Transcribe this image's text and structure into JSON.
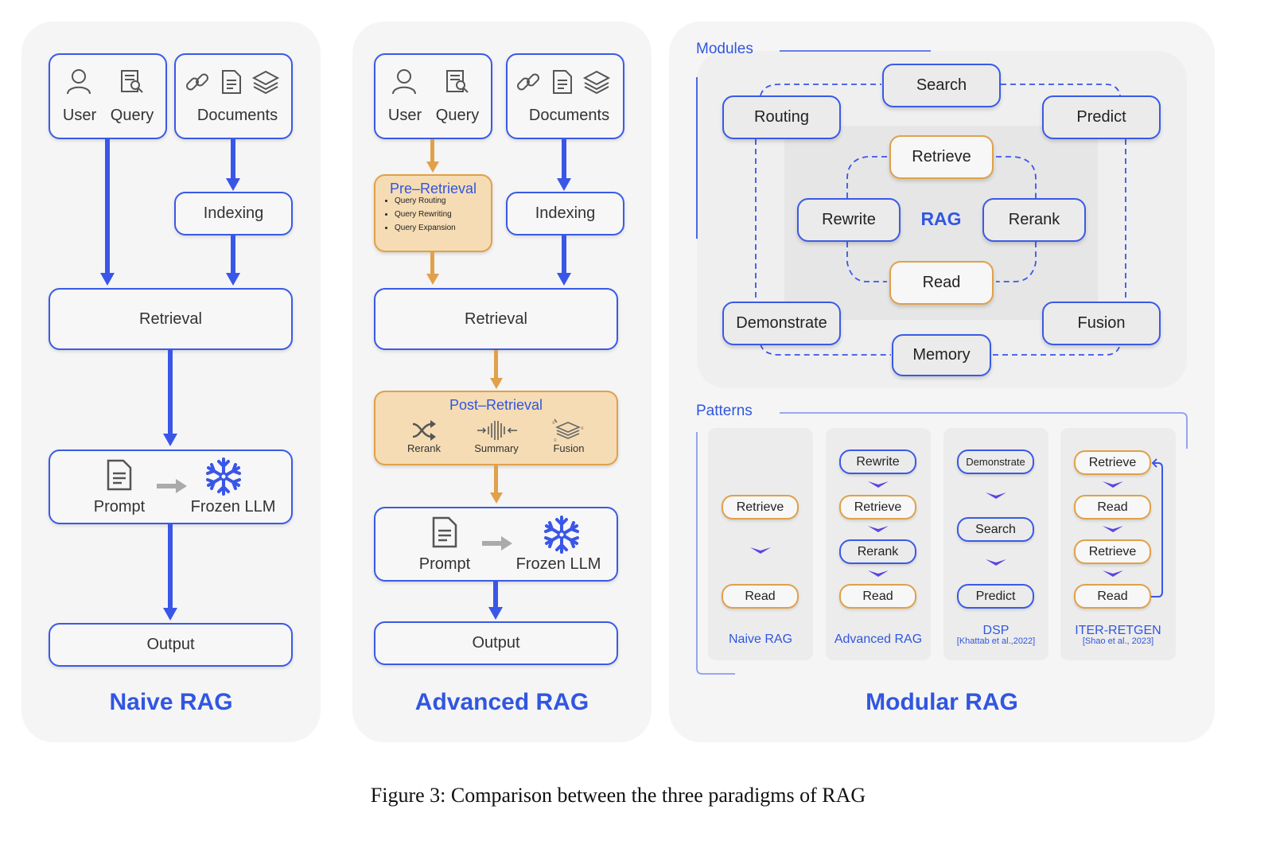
{
  "colors": {
    "accent_blue": "#3156e0",
    "orange": "#e0a14a",
    "orange_fill": "#f5dcb4",
    "panel_bg": "#f5f5f5"
  },
  "naive": {
    "title": "Naive RAG",
    "user_label": "User",
    "query_label": "Query",
    "documents_label": "Documents",
    "indexing_label": "Indexing",
    "retrieval_label": "Retrieval",
    "prompt_label": "Prompt",
    "llm_label": "Frozen LLM",
    "output_label": "Output"
  },
  "advanced": {
    "title": "Advanced RAG",
    "user_label": "User",
    "query_label": "Query",
    "documents_label": "Documents",
    "pre_retrieval": {
      "title": "Pre–Retrieval",
      "items": [
        "Query Routing",
        "Query Rewriting",
        "Query Expansion"
      ]
    },
    "indexing_label": "Indexing",
    "retrieval_label": "Retrieval",
    "post_retrieval": {
      "title": "Post–Retrieval",
      "items": [
        "Rerank",
        "Summary",
        "Fusion"
      ]
    },
    "prompt_label": "Prompt",
    "llm_label": "Frozen LLM",
    "output_label": "Output"
  },
  "modular": {
    "title": "Modular RAG",
    "modules_heading": "Modules",
    "center_label": "RAG",
    "outer_modules": [
      "Search",
      "Routing",
      "Predict",
      "Demonstrate",
      "Fusion",
      "Memory"
    ],
    "inner_modules": [
      "Retrieve",
      "Rewrite",
      "Rerank",
      "Read"
    ],
    "patterns_heading": "Patterns",
    "patterns": [
      {
        "name": "Naive RAG",
        "cite": "",
        "steps": [
          "Retrieve",
          "Read"
        ]
      },
      {
        "name": "Advanced RAG",
        "cite": "",
        "steps": [
          "Rewrite",
          "Retrieve",
          "Rerank",
          "Read"
        ]
      },
      {
        "name": "DSP",
        "cite": "[Khattab et al.,2022]",
        "steps": [
          "Demonstrate",
          "Search",
          "Predict"
        ]
      },
      {
        "name": "ITER-RETGEN",
        "cite": "[Shao et al., 2023]",
        "steps": [
          "Retrieve",
          "Read",
          "Retrieve",
          "Read"
        ]
      }
    ]
  },
  "caption": "Figure 3: Comparison between the three paradigms of RAG"
}
